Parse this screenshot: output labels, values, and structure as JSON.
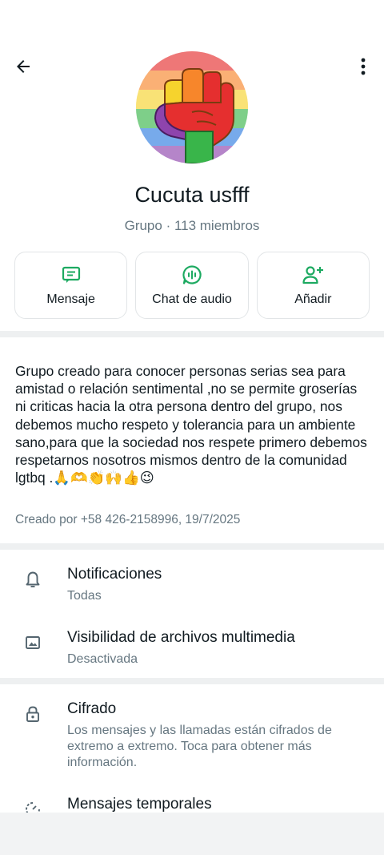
{
  "header": {
    "back_icon": "arrow-left-icon",
    "menu_icon": "more-vertical-icon"
  },
  "group": {
    "name": "Cucuta usfff",
    "meta": "Grupo · 113 miembros",
    "avatar_icon": "rainbow-fist-icon"
  },
  "actions": [
    {
      "label": "Mensaje",
      "icon": "message-icon"
    },
    {
      "label": "Chat de audio",
      "icon": "audio-chat-icon"
    },
    {
      "label": "Añadir",
      "icon": "add-person-icon"
    }
  ],
  "description": {
    "text": "Grupo creado para conocer personas serias sea para amistad o relación sentimental ,no se permite groserías ni criticas hacia la otra persona dentro del grupo, nos debemos mucho respeto  y tolerancia para un ambiente sano,para que la sociedad nos respete primero debemos respetarnos nosotros mismos dentro de la comunidad lgtbq .🙏🫶👏🙌👍😉",
    "created": "Creado por +58 426-2158996, 19/7/2025"
  },
  "settings": [
    {
      "title": "Notificaciones",
      "subtitle": "Todas",
      "icon": "bell-icon"
    },
    {
      "title": "Visibilidad de archivos multimedia",
      "subtitle": "Desactivada",
      "icon": "image-icon"
    },
    {
      "title": "Cifrado",
      "subtitle": "Los mensajes y las llamadas están cifrados de extremo a extremo. Toca para obtener más información.",
      "icon": "lock-icon"
    },
    {
      "title": "Mensajes temporales",
      "subtitle": "",
      "icon": "timer-icon"
    }
  ],
  "colors": {
    "accent": "#1daa61",
    "text": "#111b21",
    "secondary": "#667781",
    "divider": "#eef0f1"
  }
}
